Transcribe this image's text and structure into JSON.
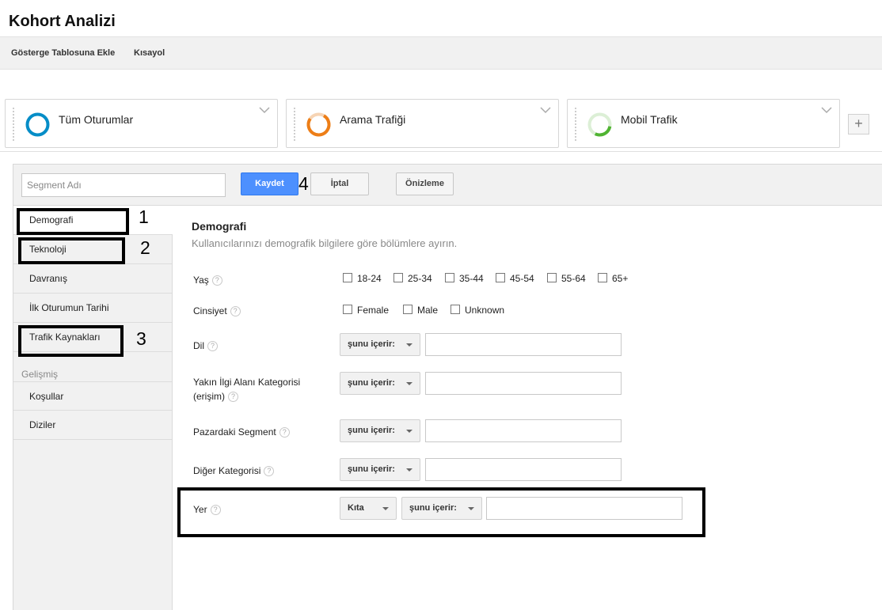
{
  "header": {
    "title": "Kohort Analizi"
  },
  "topbar": {
    "add_dashboard": "Gösterge Tablosuna Ekle",
    "shortcut": "Kısayol"
  },
  "segments": [
    {
      "label": "Tüm Oturumlar",
      "color": "#058dc7"
    },
    {
      "label": "Arama Trafiği",
      "color": "#ed7e17"
    },
    {
      "label": "Mobil Trafik",
      "color": "#50b432"
    }
  ],
  "segment_add": "+",
  "editor": {
    "segment_name_placeholder": "Segment Adı",
    "save": "Kaydet",
    "cancel": "İptal",
    "preview": "Önizleme"
  },
  "annotations": {
    "n1": "1",
    "n2": "2",
    "n3": "3",
    "n4": "4"
  },
  "sidebar": {
    "items": [
      "Demografi",
      "Teknoloji",
      "Davranış",
      "İlk Oturumun Tarihi",
      "Trafik Kaynakları"
    ],
    "advanced_heading": "Gelişmiş",
    "advanced_items": [
      "Koşullar",
      "Diziler"
    ]
  },
  "content": {
    "title": "Demografi",
    "subtitle": "Kullanıcılarınızı demografik bilgilere göre bölümlere ayırın.",
    "age": {
      "label": "Yaş",
      "options": [
        "18-24",
        "25-34",
        "35-44",
        "45-54",
        "55-64",
        "65+"
      ]
    },
    "gender": {
      "label": "Cinsiyet",
      "options": [
        "Female",
        "Male",
        "Unknown"
      ]
    },
    "help": "?",
    "contains": "şunu içerir:",
    "rows": {
      "language": "Dil",
      "affinity_line1": "Yakın İlgi Alanı Kategorisi",
      "affinity_line2": "(erişim)",
      "in_market": "Pazardaki Segment",
      "other": "Diğer Kategorisi",
      "location": "Yer"
    },
    "location_level": "Kıta"
  }
}
